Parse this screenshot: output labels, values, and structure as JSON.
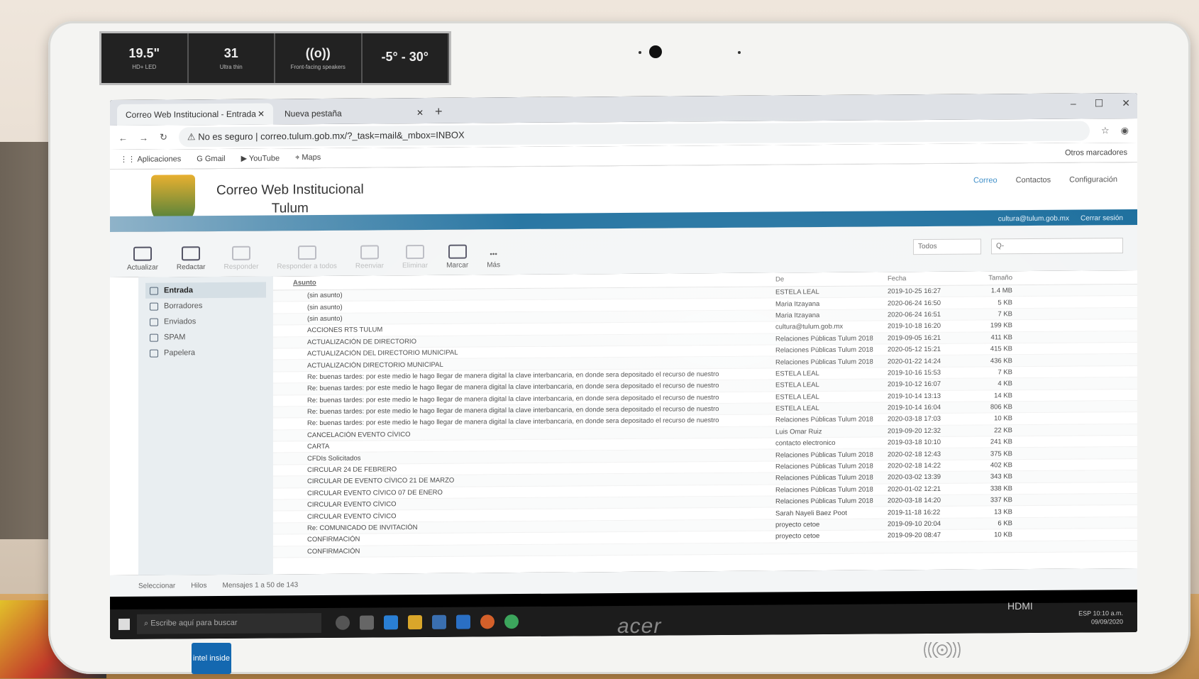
{
  "sticker": [
    {
      "value": "19.5\"",
      "caption": "HD+ LED"
    },
    {
      "value": "31",
      "caption": "Ultra thin"
    },
    {
      "value": "((o))",
      "caption": "Front-facing speakers"
    },
    {
      "value": "-5° - 30°",
      "caption": ""
    }
  ],
  "browser": {
    "tabs": [
      {
        "label": "Correo Web Institucional - Entrada"
      },
      {
        "label": "Nueva pestaña"
      }
    ],
    "security": "No es seguro",
    "url": "correo.tulum.gob.mx/?_task=mail&_mbox=INBOX",
    "bookmarks": [
      "Aplicaciones",
      "Gmail",
      "YouTube",
      "Maps"
    ],
    "other_bookmarks": "Otros marcadores"
  },
  "app": {
    "title_line1": "Correo Web Institucional",
    "title_line2": "Tulum",
    "nav": [
      "Correo",
      "Contactos",
      "Configuración"
    ],
    "user_email": "cultura@tulum.gob.mx",
    "logout": "Cerrar sesión"
  },
  "toolbar": {
    "buttons": [
      {
        "label": "Actualizar",
        "enabled": true
      },
      {
        "label": "Redactar",
        "enabled": true
      },
      {
        "label": "Responder",
        "enabled": false
      },
      {
        "label": "Responder a todos",
        "enabled": false
      },
      {
        "label": "Reenviar",
        "enabled": false
      },
      {
        "label": "Eliminar",
        "enabled": false
      },
      {
        "label": "Marcar",
        "enabled": true
      },
      {
        "label": "Más",
        "enabled": true
      }
    ],
    "filter": "Todos",
    "search_placeholder": "Q-"
  },
  "folders": [
    "Entrada",
    "Borradores",
    "Enviados",
    "SPAM",
    "Papelera"
  ],
  "list_headers": {
    "subject": "Asunto",
    "from": "De",
    "date": "Fecha",
    "size": "Tamaño"
  },
  "messages": [
    {
      "subject": "(sin asunto)",
      "from": "ESTELA LEAL",
      "date": "2019-10-25 16:27",
      "size": "1.4 MB"
    },
    {
      "subject": "(sin asunto)",
      "from": "Maria Itzayana",
      "date": "2020-06-24 16:50",
      "size": "5 KB"
    },
    {
      "subject": "(sin asunto)",
      "from": "Maria Itzayana",
      "date": "2020-06-24 16:51",
      "size": "7 KB"
    },
    {
      "subject": "ACCIONES RTS TULUM",
      "from": "cultura@tulum.gob.mx",
      "date": "2019-10-18 16:20",
      "size": "199 KB"
    },
    {
      "subject": "ACTUALIZACIÓN DE DIRECTORIO",
      "from": "Relaciones Públicas Tulum 2018",
      "date": "2019-09-05 16:21",
      "size": "411 KB"
    },
    {
      "subject": "ACTUALIZACIÓN DEL DIRECTORIO MUNICIPAL",
      "from": "Relaciones Públicas Tulum 2018",
      "date": "2020-05-12 15:21",
      "size": "415 KB"
    },
    {
      "subject": "ACTUALIZACIÓN DIRECTORIO MUNICIPAL",
      "from": "Relaciones Públicas Tulum 2018",
      "date": "2020-01-22 14:24",
      "size": "436 KB"
    },
    {
      "subject": "Re: buenas tardes: por este medio le hago llegar de manera digital la clave interbancaria, en donde sera depositado el recurso de nuestro",
      "from": "ESTELA LEAL",
      "date": "2019-10-16 15:53",
      "size": "7 KB"
    },
    {
      "subject": "Re: buenas tardes: por este medio le hago llegar de manera digital la clave interbancaria, en donde sera depositado el recurso de nuestro",
      "from": "ESTELA LEAL",
      "date": "2019-10-12 16:07",
      "size": "4 KB"
    },
    {
      "subject": "Re: buenas tardes: por este medio le hago llegar de manera digital la clave interbancaria, en donde sera depositado el recurso de nuestro",
      "from": "ESTELA LEAL",
      "date": "2019-10-14 13:13",
      "size": "14 KB"
    },
    {
      "subject": "Re: buenas tardes: por este medio le hago llegar de manera digital la clave interbancaria, en donde sera depositado el recurso de nuestro",
      "from": "ESTELA LEAL",
      "date": "2019-10-14 16:04",
      "size": "806 KB"
    },
    {
      "subject": "Re: buenas tardes: por este medio le hago llegar de manera digital la clave interbancaria, en donde sera depositado el recurso de nuestro",
      "from": "Relaciones Públicas Tulum 2018",
      "date": "2020-03-18 17:03",
      "size": "10 KB"
    },
    {
      "subject": "CANCELACIÓN EVENTO CÍVICO",
      "from": "Luis Omar Ruiz",
      "date": "2019-09-20 12:32",
      "size": "22 KB"
    },
    {
      "subject": "CARTA",
      "from": "contacto electronico",
      "date": "2019-03-18 10:10",
      "size": "241 KB"
    },
    {
      "subject": "CFDIs Solicitados",
      "from": "Relaciones Públicas Tulum 2018",
      "date": "2020-02-18 12:43",
      "size": "375 KB"
    },
    {
      "subject": "CIRCULAR 24 DE FEBRERO",
      "from": "Relaciones Públicas Tulum 2018",
      "date": "2020-02-18 14:22",
      "size": "402 KB"
    },
    {
      "subject": "CIRCULAR DE EVENTO CÍVICO 21 DE MARZO",
      "from": "Relaciones Públicas Tulum 2018",
      "date": "2020-03-02 13:39",
      "size": "343 KB"
    },
    {
      "subject": "CIRCULAR EVENTO CÍVICO 07 DE ENERO",
      "from": "Relaciones Públicas Tulum 2018",
      "date": "2020-01-02 12:21",
      "size": "338 KB"
    },
    {
      "subject": "CIRCULAR EVENTO CÍVICO",
      "from": "Relaciones Públicas Tulum 2018",
      "date": "2020-03-18 14:20",
      "size": "337 KB"
    },
    {
      "subject": "CIRCULAR EVENTO CÍVICO",
      "from": "Sarah Nayeli Baez Poot",
      "date": "2019-11-18 16:22",
      "size": "13 KB"
    },
    {
      "subject": "Re: COMUNICADO DE INVITACIÓN",
      "from": "proyecto cetoe",
      "date": "2019-09-10 20:04",
      "size": "6 KB"
    },
    {
      "subject": "CONFIRMACIÓN",
      "from": "proyecto cetoe",
      "date": "2019-09-20 08:47",
      "size": "10 KB"
    },
    {
      "subject": "CONFIRMACIÓN",
      "from": "",
      "date": "",
      "size": ""
    }
  ],
  "footer": {
    "select": "Seleccionar",
    "threads": "Hilos",
    "count": "Mensajes 1 a 50 de 143"
  },
  "taskbar": {
    "search_placeholder": "Escribe aquí para buscar",
    "time": "10:10 a.m.",
    "date": "09/09/2020",
    "lang": "ESP"
  },
  "brand": {
    "monitor": "acer",
    "badge": "intel inside",
    "port": "HDMI"
  }
}
